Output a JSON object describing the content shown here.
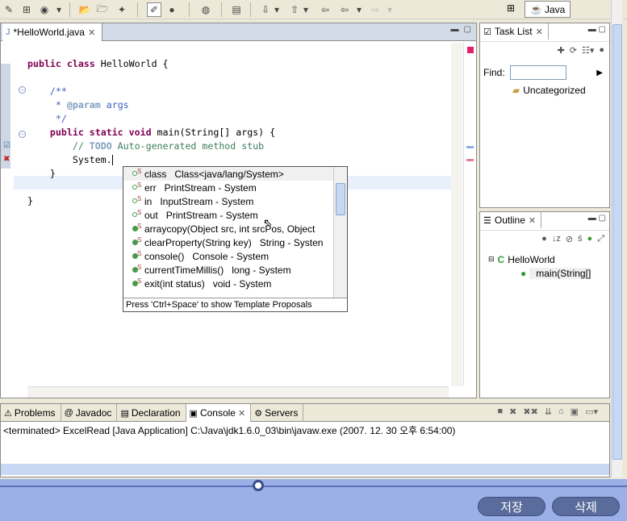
{
  "toolbar": {
    "perspective_label": "Java"
  },
  "editor": {
    "tab_label": "*HelloWorld.java",
    "code_lines": [
      {
        "parts": [
          [
            "kw",
            "public class"
          ],
          [
            "",
            " HelloWorld {"
          ]
        ]
      },
      {
        "parts": [
          [
            "",
            ""
          ]
        ]
      },
      {
        "parts": [
          [
            "cm",
            "    /**"
          ]
        ]
      },
      {
        "parts": [
          [
            "cm",
            "     * "
          ],
          [
            "tag",
            "@param"
          ],
          [
            "cm",
            " args"
          ]
        ]
      },
      {
        "parts": [
          [
            "cm",
            "     */"
          ]
        ]
      },
      {
        "parts": [
          [
            "kw",
            "    public static void"
          ],
          [
            "",
            " main(String[] args) {"
          ]
        ]
      },
      {
        "parts": [
          [
            "lc",
            "        // "
          ],
          [
            "todo",
            "TODO"
          ],
          [
            "lc",
            " Auto-generated method stub"
          ]
        ]
      },
      {
        "parts": [
          [
            "",
            "        System."
          ]
        ]
      },
      {
        "parts": [
          [
            "",
            "    }"
          ]
        ]
      },
      {
        "parts": [
          [
            "",
            ""
          ]
        ]
      },
      {
        "parts": [
          [
            "",
            "}"
          ]
        ]
      }
    ]
  },
  "assist": {
    "items": [
      {
        "name": "class",
        "detail": "Class<java/lang/System>",
        "icon": "static-field-icon",
        "selected": true
      },
      {
        "name": "err",
        "detail": "PrintStream - System",
        "icon": "static-field-icon"
      },
      {
        "name": "in",
        "detail": "InputStream - System",
        "icon": "static-field-icon"
      },
      {
        "name": "out",
        "detail": "PrintStream - System",
        "icon": "static-field-icon"
      },
      {
        "name": "arraycopy(Object src, int srcPos, Object",
        "detail": "",
        "icon": "static-method-icon"
      },
      {
        "name": "clearProperty(String key)",
        "detail": "String - Systen",
        "icon": "static-method-icon"
      },
      {
        "name": "console()",
        "detail": "Console - System",
        "icon": "static-method-icon"
      },
      {
        "name": "currentTimeMillis()",
        "detail": "long - System",
        "icon": "static-method-icon"
      },
      {
        "name": "exit(int status)",
        "detail": "void - System",
        "icon": "static-method-icon"
      }
    ],
    "status": "Press 'Ctrl+Space' to show Template Proposals"
  },
  "tasklist": {
    "tab_label": "Task List",
    "find_label": "Find:",
    "find_value": "",
    "category": "Uncategorized"
  },
  "outline": {
    "tab_label": "Outline",
    "class_name": "HelloWorld",
    "method_name": "main(String[]"
  },
  "bottom": {
    "tabs": [
      {
        "label": "Problems",
        "icon": "problems-icon"
      },
      {
        "label": "Javadoc",
        "icon": "at-icon"
      },
      {
        "label": "Declaration",
        "icon": "declaration-icon"
      },
      {
        "label": "Console",
        "icon": "console-icon",
        "active": true
      },
      {
        "label": "Servers",
        "icon": "servers-icon"
      }
    ],
    "console_text": "<terminated> ExcelRead [Java Application] C:\\Java\\jdk1.6.0_03\\bin\\javaw.exe (2007. 12. 30 오후 6:54:00)"
  },
  "footer": {
    "save_label": "저장",
    "delete_label": "삭제"
  }
}
